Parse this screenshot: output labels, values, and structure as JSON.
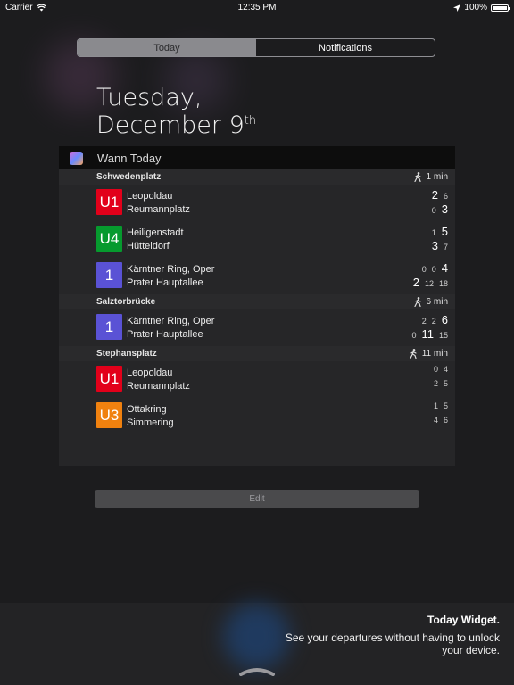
{
  "status_bar": {
    "carrier": "Carrier",
    "time": "12:35 PM",
    "battery_text": "100%",
    "battery_level": 1.0
  },
  "segmented_control": {
    "today": "Today",
    "notifications": "Notifications",
    "selected": "Today"
  },
  "date": {
    "weekday": "Tuesday,",
    "month_day": "December 9",
    "suffix": "th"
  },
  "widget": {
    "title": "Wann Today",
    "icon": "wann-app-icon",
    "stops": [
      {
        "name": "Schwedenplatz",
        "walk": "1 min",
        "lines": [
          {
            "badge": "U1",
            "color": "#e2001a",
            "dest1": "Leopoldau",
            "dest2": "Reumannplatz",
            "row1": [
              {
                "v": "2",
                "big": true
              },
              {
                "v": "6",
                "big": false
              }
            ],
            "row2": [
              {
                "v": "0",
                "big": false
              },
              {
                "v": "3",
                "big": true
              }
            ]
          },
          {
            "badge": "U4",
            "color": "#069a2e",
            "dest1": "Heiligenstadt",
            "dest2": "Hütteldorf",
            "row1": [
              {
                "v": "1",
                "big": false
              },
              {
                "v": "5",
                "big": true
              }
            ],
            "row2": [
              {
                "v": "3",
                "big": true
              },
              {
                "v": "7",
                "big": false
              }
            ]
          },
          {
            "badge": "1",
            "color": "#5a52d5",
            "dest1": "Kärntner Ring, Oper",
            "dest2": "Prater Hauptallee",
            "row1": [
              {
                "v": "0",
                "big": false
              },
              {
                "v": "0",
                "big": false
              },
              {
                "v": "4",
                "big": true
              }
            ],
            "row2": [
              {
                "v": "2",
                "big": true
              },
              {
                "v": "12",
                "big": false
              },
              {
                "v": "18",
                "big": false
              }
            ]
          }
        ]
      },
      {
        "name": "Salztorbrücke",
        "walk": "6 min",
        "lines": [
          {
            "badge": "1",
            "color": "#5a52d5",
            "dest1": "Kärntner Ring, Oper",
            "dest2": "Prater Hauptallee",
            "row1": [
              {
                "v": "2",
                "big": false
              },
              {
                "v": "2",
                "big": false
              },
              {
                "v": "6",
                "big": true
              }
            ],
            "row2": [
              {
                "v": "0",
                "big": false
              },
              {
                "v": "11",
                "big": true
              },
              {
                "v": "15",
                "big": false
              }
            ]
          }
        ]
      },
      {
        "name": "Stephansplatz",
        "walk": "11 min",
        "lines": [
          {
            "badge": "U1",
            "color": "#e2001a",
            "dest1": "Leopoldau",
            "dest2": "Reumannplatz",
            "row1": [
              {
                "v": "0",
                "big": false
              },
              {
                "v": "4",
                "big": false
              }
            ],
            "row2": [
              {
                "v": "2",
                "big": false
              },
              {
                "v": "5",
                "big": false
              }
            ]
          },
          {
            "badge": "U3",
            "color": "#f0810f",
            "dest1": "Ottakring",
            "dest2": "Simmering",
            "row1": [
              {
                "v": "1",
                "big": false
              },
              {
                "v": "5",
                "big": false
              }
            ],
            "row2": [
              {
                "v": "4",
                "big": false
              },
              {
                "v": "6",
                "big": false
              }
            ]
          }
        ]
      }
    ]
  },
  "edit_button": {
    "label": "Edit"
  },
  "banner": {
    "title": "Today Widget.",
    "text": "See your departures without having to unlock your device."
  }
}
